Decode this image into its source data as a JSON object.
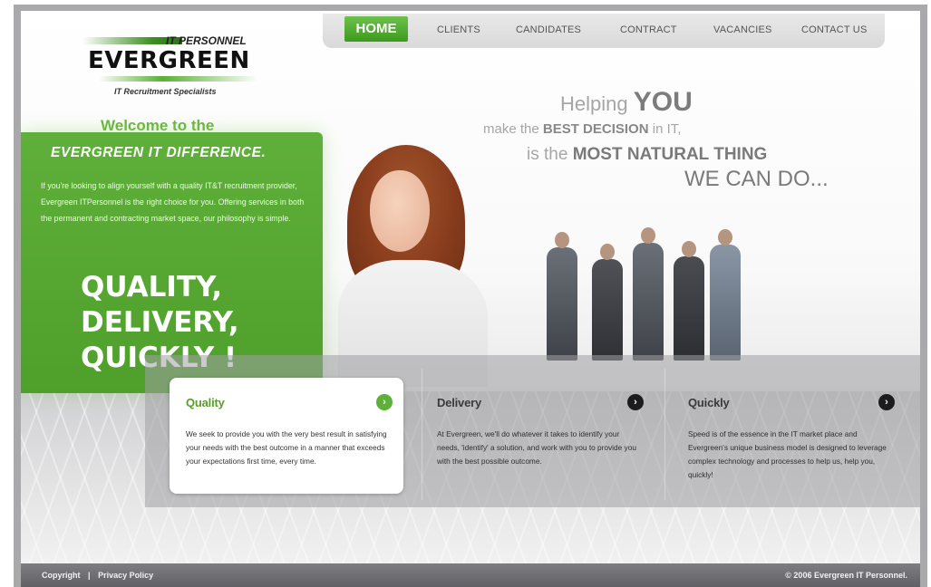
{
  "nav": {
    "items": [
      "HOME",
      "CLIENTS",
      "CANDIDATES",
      "CONTRACT",
      "VACANCIES",
      "CONTACT US"
    ]
  },
  "logo": {
    "small": "IT PERSONNEL",
    "big": "EVERGREEN",
    "tagline": "IT Recruitment Specialists"
  },
  "welcome": "Welcome to the",
  "intro": {
    "heading": "EVERGREEN IT DIFFERENCE.",
    "text": "If you're looking to align yourself with a quality IT&T recruitment provider, Evergreen ITPersonnel is the right choice for you. Offering services in both the permanent and contracting market space, our philosophy is simple.",
    "slogan_1": "QUALITY,",
    "slogan_2": "DELIVERY,",
    "slogan_3": "QUICKLY !"
  },
  "headline": {
    "l1_pre": "Helping ",
    "l1_bold": "YOU",
    "l2_pre": "make the ",
    "l2_bold": "BEST DECISION",
    "l2_post": " in IT,",
    "l3_pre": "is the ",
    "l3_bold": "MOST NATURAL THING",
    "l4": "WE CAN DO..."
  },
  "cards": [
    {
      "title": "Quality",
      "text": "We seek to provide you with the very best result in satisfying your needs with the best outcome in a manner that exceeds your expectations first time, every time."
    },
    {
      "title": "Delivery",
      "text": "At Evergreen, we'll do whatever it takes to identify your needs, 'identify' a solution, and work with you to provide you with the best possible outcome."
    },
    {
      "title": "Quickly",
      "text": "Speed is of the essence in the IT market place and Evergreen's unique business model is designed to leverage complex technology and processes to help us, help you, quickly!"
    }
  ],
  "footer": {
    "copyright": "Copyright",
    "separator": "|",
    "privacy": "Privacy Policy",
    "right": "© 2006 Evergreen IT Personnel."
  },
  "colors": {
    "brand_green": "#5fb03a",
    "nav_active": "#4ea42a",
    "footer_bg": "#6e6e72"
  },
  "icons": {
    "card_arrow_active": "chevron-right-circle-green",
    "card_arrow": "chevron-right-circle-dark"
  }
}
